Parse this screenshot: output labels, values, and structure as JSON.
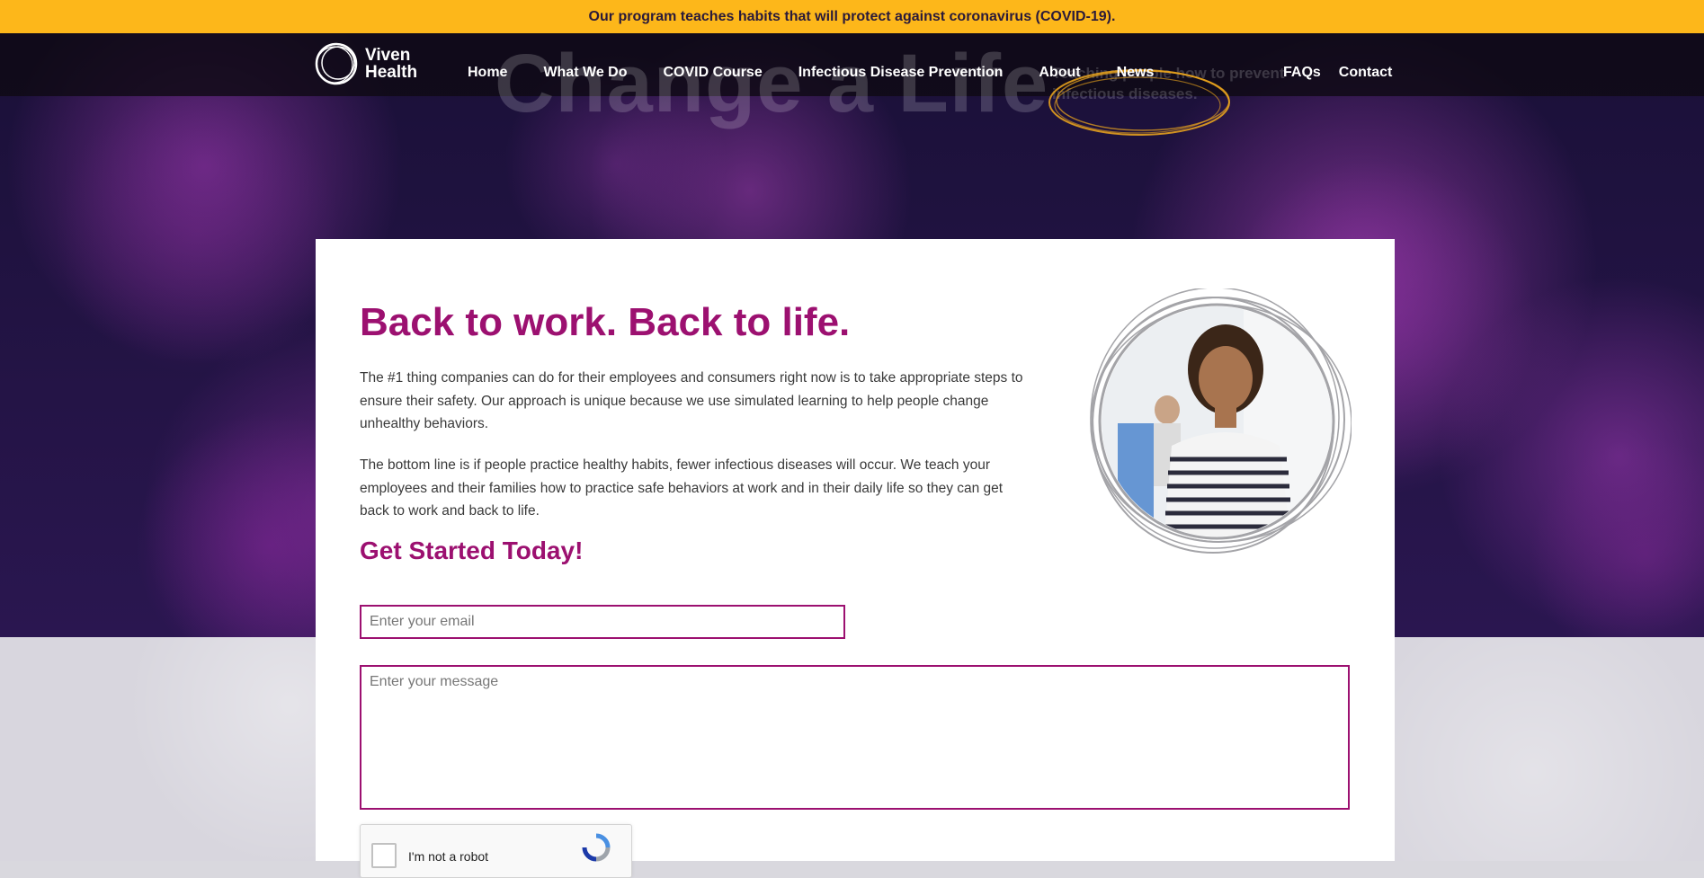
{
  "announcement": "Our program teaches habits that will protect against coronavirus (COVID-19).",
  "logo": {
    "line1": "Viven",
    "line2": "Health"
  },
  "nav": {
    "items": [
      "Home",
      "What We Do",
      "COVID Course",
      "Infectious Disease Prevention",
      "About",
      "News"
    ],
    "right_items": [
      "FAQs",
      "Contact"
    ]
  },
  "hero": {
    "title": "Change a Life",
    "tagline": "Teaching people how to prevent infectious diseases."
  },
  "main": {
    "headline": "Back to work. Back to life.",
    "paragraph1": "The #1 thing companies can do for their employees and consumers right now is to take appropriate steps to ensure their safety. Our approach is unique because we use simulated learning to help people change unhealthy behaviors.",
    "paragraph2": "The bottom line is if people practice healthy habits, fewer infectious diseases will occur. We teach your employees and their families how to practice safe behaviors at work and in their daily life so they can get back to work and back to life.",
    "subheading": "Get Started Today!"
  },
  "form": {
    "email_placeholder": "Enter your email",
    "message_placeholder": "Enter your message",
    "recaptcha_label": "I'm not a robot"
  },
  "colors": {
    "brand": "#9c1070",
    "banner": "#fdb71a",
    "accent_scribble": "#f0a81c"
  },
  "icons": [
    "viven-health-logo-icon",
    "recaptcha-logo-icon"
  ]
}
